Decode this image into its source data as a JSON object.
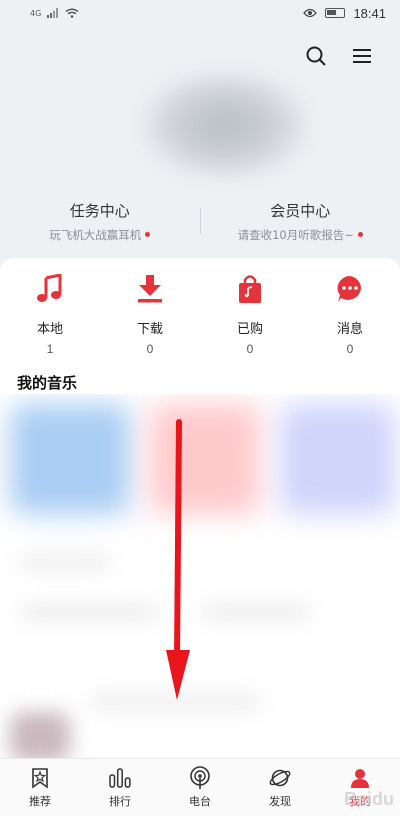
{
  "status": {
    "network": "4G",
    "time": "18:41"
  },
  "center": {
    "task_title": "任务中心",
    "task_sub": "玩飞机大战赢耳机",
    "vip_title": "会员中心",
    "vip_sub": "请查收10月听歌报告~"
  },
  "quick": [
    {
      "label": "本地",
      "count": "1",
      "icon": "music-note-icon"
    },
    {
      "label": "下载",
      "count": "0",
      "icon": "download-icon"
    },
    {
      "label": "已购",
      "count": "0",
      "icon": "shopping-bag-icon"
    },
    {
      "label": "消息",
      "count": "0",
      "icon": "message-icon"
    }
  ],
  "section_title": "我的音乐",
  "nav": [
    {
      "label": "推荐",
      "icon": "star-bookmark-icon"
    },
    {
      "label": "排行",
      "icon": "bars-icon"
    },
    {
      "label": "电台",
      "icon": "radio-icon"
    },
    {
      "label": "发现",
      "icon": "planet-icon"
    },
    {
      "label": "我的",
      "icon": "user-icon"
    }
  ],
  "watermark": "Baidu",
  "colors": {
    "accent": "#e3343c",
    "background": "#eef1f4",
    "arrow": "#e8151c"
  }
}
